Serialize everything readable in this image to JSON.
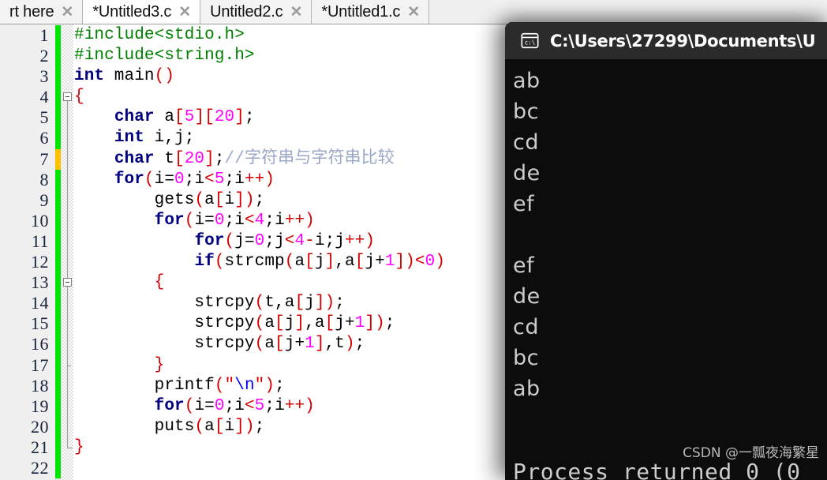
{
  "editor": {
    "tabs": [
      {
        "label": "rt here",
        "active": false,
        "close_icon": "✕",
        "truncated_left": true
      },
      {
        "label": "*Untitled3.c",
        "active": true,
        "close_icon": "✕"
      },
      {
        "label": "Untitled2.c",
        "active": false,
        "close_icon": "✕"
      },
      {
        "label": "*Untitled1.c",
        "active": false,
        "close_icon": "✕"
      }
    ],
    "line_numbers": [
      "1",
      "2",
      "3",
      "4",
      "5",
      "6",
      "7",
      "8",
      "9",
      "10",
      "11",
      "12",
      "13",
      "14",
      "15",
      "16",
      "17",
      "18",
      "19",
      "20",
      "21",
      "22"
    ],
    "change_marker_color": "#00e500",
    "change_marker_warn_color": "#ffc000",
    "colors": {
      "keyword": "#00007f",
      "preprocessor": "#008000",
      "bracket": "#d40000",
      "number": "#ff00ff",
      "string": "#0000ff",
      "comment": "#9aa7c7",
      "gutter_bg": "#f0f0f0",
      "editor_bg": "#ffffff"
    },
    "code_lines": [
      {
        "n": 1,
        "tokens": [
          {
            "t": "#include<stdio.h>",
            "c": "pp"
          }
        ]
      },
      {
        "n": 2,
        "tokens": [
          {
            "t": "#include<string.h>",
            "c": "pp"
          }
        ]
      },
      {
        "n": 3,
        "tokens": [
          {
            "t": "int",
            "c": "k"
          },
          {
            "t": " main",
            "c": "pl"
          },
          {
            "t": "()",
            "c": "br"
          }
        ]
      },
      {
        "n": 4,
        "tokens": [
          {
            "t": "{",
            "c": "br"
          }
        ]
      },
      {
        "n": 5,
        "tokens": [
          {
            "t": "    ",
            "c": "pl"
          },
          {
            "t": "char",
            "c": "k"
          },
          {
            "t": " a",
            "c": "pl"
          },
          {
            "t": "[",
            "c": "br"
          },
          {
            "t": "5",
            "c": "num"
          },
          {
            "t": "]",
            "c": "br"
          },
          {
            "t": "[",
            "c": "br"
          },
          {
            "t": "20",
            "c": "num"
          },
          {
            "t": "]",
            "c": "br"
          },
          {
            "t": ";",
            "c": "pl"
          }
        ]
      },
      {
        "n": 6,
        "tokens": [
          {
            "t": "    ",
            "c": "pl"
          },
          {
            "t": "int",
            "c": "k"
          },
          {
            "t": " i,j;",
            "c": "pl"
          }
        ]
      },
      {
        "n": 7,
        "tokens": [
          {
            "t": "    ",
            "c": "pl"
          },
          {
            "t": "char",
            "c": "k"
          },
          {
            "t": " t",
            "c": "pl"
          },
          {
            "t": "[",
            "c": "br"
          },
          {
            "t": "20",
            "c": "num"
          },
          {
            "t": "]",
            "c": "br"
          },
          {
            "t": ";",
            "c": "pl"
          },
          {
            "t": "//字符串与字符串比较",
            "c": "cmt"
          }
        ]
      },
      {
        "n": 8,
        "tokens": [
          {
            "t": "    ",
            "c": "pl"
          },
          {
            "t": "for",
            "c": "k"
          },
          {
            "t": "(",
            "c": "br"
          },
          {
            "t": "i=",
            "c": "pl"
          },
          {
            "t": "0",
            "c": "num"
          },
          {
            "t": ";",
            "c": "pl"
          },
          {
            "t": "i",
            "c": "pl"
          },
          {
            "t": "<",
            "c": "op"
          },
          {
            "t": "5",
            "c": "num"
          },
          {
            "t": ";",
            "c": "pl"
          },
          {
            "t": "i",
            "c": "pl"
          },
          {
            "t": "++",
            "c": "op"
          },
          {
            "t": ")",
            "c": "br"
          }
        ]
      },
      {
        "n": 9,
        "tokens": [
          {
            "t": "        gets",
            "c": "pl"
          },
          {
            "t": "(",
            "c": "br"
          },
          {
            "t": "a",
            "c": "pl"
          },
          {
            "t": "[",
            "c": "br"
          },
          {
            "t": "i",
            "c": "pl"
          },
          {
            "t": "]",
            "c": "br"
          },
          {
            "t": ")",
            "c": "br"
          },
          {
            "t": ";",
            "c": "pl"
          }
        ]
      },
      {
        "n": 10,
        "tokens": [
          {
            "t": "        ",
            "c": "pl"
          },
          {
            "t": "for",
            "c": "k"
          },
          {
            "t": "(",
            "c": "br"
          },
          {
            "t": "i=",
            "c": "pl"
          },
          {
            "t": "0",
            "c": "num"
          },
          {
            "t": ";",
            "c": "pl"
          },
          {
            "t": "i",
            "c": "pl"
          },
          {
            "t": "<",
            "c": "op"
          },
          {
            "t": "4",
            "c": "num"
          },
          {
            "t": ";",
            "c": "pl"
          },
          {
            "t": "i",
            "c": "pl"
          },
          {
            "t": "++",
            "c": "op"
          },
          {
            "t": ")",
            "c": "br"
          }
        ]
      },
      {
        "n": 11,
        "tokens": [
          {
            "t": "            ",
            "c": "pl"
          },
          {
            "t": "for",
            "c": "k"
          },
          {
            "t": "(",
            "c": "br"
          },
          {
            "t": "j=",
            "c": "pl"
          },
          {
            "t": "0",
            "c": "num"
          },
          {
            "t": ";",
            "c": "pl"
          },
          {
            "t": "j",
            "c": "pl"
          },
          {
            "t": "<",
            "c": "op"
          },
          {
            "t": "4",
            "c": "num"
          },
          {
            "t": "-",
            "c": "op"
          },
          {
            "t": "i",
            "c": "pl"
          },
          {
            "t": ";",
            "c": "pl"
          },
          {
            "t": "j",
            "c": "pl"
          },
          {
            "t": "++",
            "c": "op"
          },
          {
            "t": ")",
            "c": "br"
          }
        ]
      },
      {
        "n": 12,
        "tokens": [
          {
            "t": "            ",
            "c": "pl"
          },
          {
            "t": "if",
            "c": "k"
          },
          {
            "t": "(",
            "c": "br"
          },
          {
            "t": "strcmp",
            "c": "pl"
          },
          {
            "t": "(",
            "c": "br"
          },
          {
            "t": "a",
            "c": "pl"
          },
          {
            "t": "[",
            "c": "br"
          },
          {
            "t": "j",
            "c": "pl"
          },
          {
            "t": "]",
            "c": "br"
          },
          {
            "t": ",a",
            "c": "pl"
          },
          {
            "t": "[",
            "c": "br"
          },
          {
            "t": "j+",
            "c": "pl"
          },
          {
            "t": "1",
            "c": "num"
          },
          {
            "t": "]",
            "c": "br"
          },
          {
            "t": ")",
            "c": "br"
          },
          {
            "t": "<",
            "c": "op"
          },
          {
            "t": "0",
            "c": "num"
          },
          {
            "t": ")",
            "c": "br"
          }
        ]
      },
      {
        "n": 13,
        "tokens": [
          {
            "t": "        ",
            "c": "pl"
          },
          {
            "t": "{",
            "c": "br"
          }
        ]
      },
      {
        "n": 14,
        "tokens": [
          {
            "t": "            strcpy",
            "c": "pl"
          },
          {
            "t": "(",
            "c": "br"
          },
          {
            "t": "t,a",
            "c": "pl"
          },
          {
            "t": "[",
            "c": "br"
          },
          {
            "t": "j",
            "c": "pl"
          },
          {
            "t": "]",
            "c": "br"
          },
          {
            "t": ")",
            "c": "br"
          },
          {
            "t": ";",
            "c": "pl"
          }
        ]
      },
      {
        "n": 15,
        "tokens": [
          {
            "t": "            strcpy",
            "c": "pl"
          },
          {
            "t": "(",
            "c": "br"
          },
          {
            "t": "a",
            "c": "pl"
          },
          {
            "t": "[",
            "c": "br"
          },
          {
            "t": "j",
            "c": "pl"
          },
          {
            "t": "]",
            "c": "br"
          },
          {
            "t": ",a",
            "c": "pl"
          },
          {
            "t": "[",
            "c": "br"
          },
          {
            "t": "j+",
            "c": "pl"
          },
          {
            "t": "1",
            "c": "num"
          },
          {
            "t": "]",
            "c": "br"
          },
          {
            "t": ")",
            "c": "br"
          },
          {
            "t": ";",
            "c": "pl"
          }
        ]
      },
      {
        "n": 16,
        "tokens": [
          {
            "t": "            strcpy",
            "c": "pl"
          },
          {
            "t": "(",
            "c": "br"
          },
          {
            "t": "a",
            "c": "pl"
          },
          {
            "t": "[",
            "c": "br"
          },
          {
            "t": "j+",
            "c": "pl"
          },
          {
            "t": "1",
            "c": "num"
          },
          {
            "t": "]",
            "c": "br"
          },
          {
            "t": ",t",
            "c": "pl"
          },
          {
            "t": ")",
            "c": "br"
          },
          {
            "t": ";",
            "c": "pl"
          }
        ]
      },
      {
        "n": 17,
        "tokens": [
          {
            "t": "        ",
            "c": "pl"
          },
          {
            "t": "}",
            "c": "br"
          }
        ]
      },
      {
        "n": 18,
        "tokens": [
          {
            "t": "        printf",
            "c": "pl"
          },
          {
            "t": "(",
            "c": "br"
          },
          {
            "t": "\"",
            "c": "br"
          },
          {
            "t": "\\n",
            "c": "str"
          },
          {
            "t": "\"",
            "c": "br"
          },
          {
            "t": ")",
            "c": "br"
          },
          {
            "t": ";",
            "c": "pl"
          }
        ]
      },
      {
        "n": 19,
        "tokens": [
          {
            "t": "        ",
            "c": "pl"
          },
          {
            "t": "for",
            "c": "k"
          },
          {
            "t": "(",
            "c": "br"
          },
          {
            "t": "i=",
            "c": "pl"
          },
          {
            "t": "0",
            "c": "num"
          },
          {
            "t": ";",
            "c": "pl"
          },
          {
            "t": "i",
            "c": "pl"
          },
          {
            "t": "<",
            "c": "op"
          },
          {
            "t": "5",
            "c": "num"
          },
          {
            "t": ";",
            "c": "pl"
          },
          {
            "t": "i",
            "c": "pl"
          },
          {
            "t": "++",
            "c": "op"
          },
          {
            "t": ")",
            "c": "br"
          }
        ]
      },
      {
        "n": 20,
        "tokens": [
          {
            "t": "        puts",
            "c": "pl"
          },
          {
            "t": "(",
            "c": "br"
          },
          {
            "t": "a",
            "c": "pl"
          },
          {
            "t": "[",
            "c": "br"
          },
          {
            "t": "i",
            "c": "pl"
          },
          {
            "t": "]",
            "c": "br"
          },
          {
            "t": ")",
            "c": "br"
          },
          {
            "t": ";",
            "c": "pl"
          }
        ]
      },
      {
        "n": 21,
        "tokens": [
          {
            "t": "}",
            "c": "br"
          }
        ]
      },
      {
        "n": 22,
        "tokens": []
      }
    ]
  },
  "console": {
    "icon_name": "command-prompt-icon",
    "icon_text": "c:\\",
    "title": "C:\\Users\\27299\\Documents\\U",
    "title_bar_color": "#2b2b2b",
    "background_color": "#0c0c0c",
    "text_color": "#cccccc",
    "output_lines": [
      "ab",
      "bc",
      "cd",
      "de",
      "ef",
      "",
      "ef",
      "de",
      "cd",
      "bc",
      "ab",
      ""
    ],
    "last_line": "Process returned 0 (0",
    "watermark": "CSDN @一瓢夜海繁星"
  }
}
